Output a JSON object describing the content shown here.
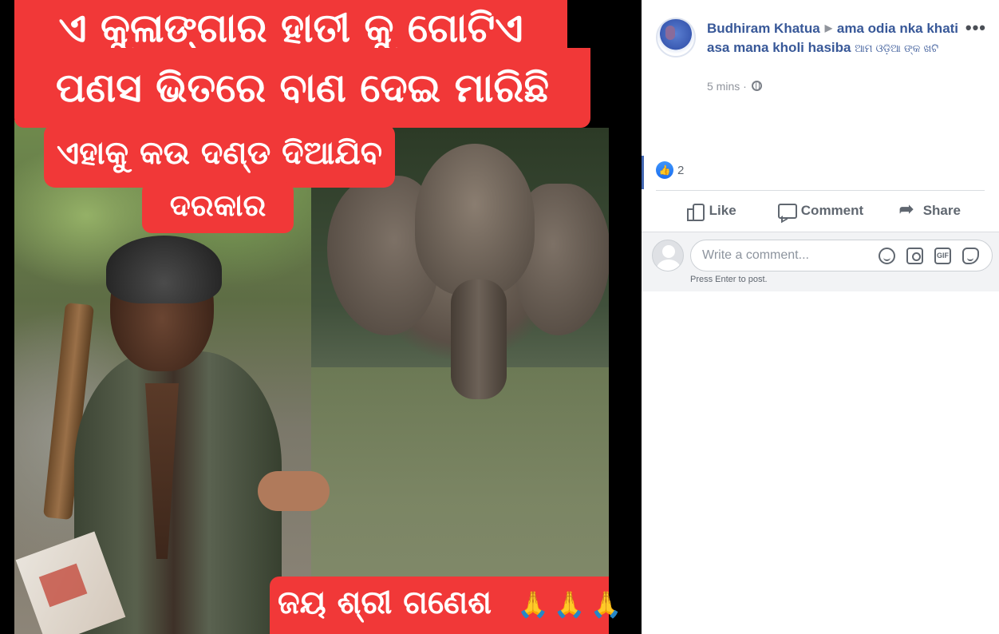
{
  "photo": {
    "band1": "ଏ କୁଳାଙ୍ଗାର ହାତୀ କୁ ଗୋଟିଏ",
    "band2": "ପଣସ ଭିତରେ ବାଣ ଦେଇ ମାରିଛି",
    "band3": "ଏହାକୁ କଉ ଦଣ୍ଡ ଦିଆଯିବ",
    "band4": "ଦରକାର",
    "band5": "ଜୟ ଶ୍ରୀ ଗଣେଶ",
    "band5_emoji": "🙏🙏🙏"
  },
  "post": {
    "author": "Budhiram Khatua",
    "group": "ama odia nka khati asa mana kholi hasiba",
    "group_suffix": "ଆମ ଓଡ଼ିଆ ଙ୍କ ଖଟି",
    "timestamp": "5 mins",
    "timestamp_sep": "·",
    "more": "•••",
    "like_count": "2",
    "actions": {
      "like": "Like",
      "comment": "Comment",
      "share": "Share"
    },
    "comment": {
      "placeholder": "Write a comment...",
      "hint": "Press Enter to post.",
      "gif_label": "GIF"
    }
  },
  "colors": {
    "band_red": "#f13838",
    "link_blue": "#385898",
    "like_blue": "#1b6ef0",
    "text_gray": "#606770",
    "comment_bg": "#f2f3f5"
  }
}
